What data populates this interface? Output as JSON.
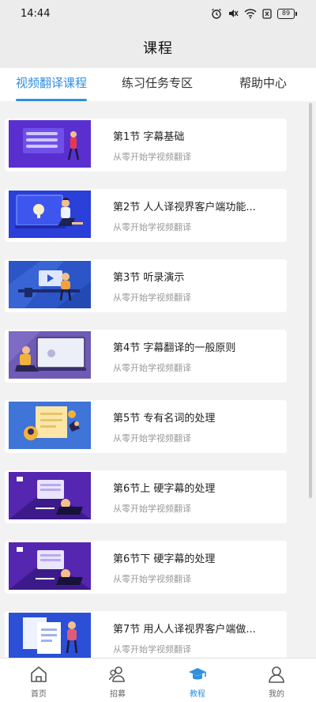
{
  "status_bar": {
    "time": "14:44",
    "battery": "89"
  },
  "header": {
    "title": "课程"
  },
  "tabs": [
    {
      "label": "视频翻译课程",
      "active": true
    },
    {
      "label": "练习任务专区",
      "active": false
    },
    {
      "label": "帮助中心",
      "active": false
    }
  ],
  "courses": [
    {
      "title": "第1节 字幕基础",
      "subtitle": "从零开始学视频翻译",
      "thumb_icon": "subtitle-basics-illustration"
    },
    {
      "title": "第2节 人人译视界客户端功能...",
      "subtitle": "从零开始学视频翻译",
      "thumb_icon": "client-features-illustration"
    },
    {
      "title": "第3节 听录演示",
      "subtitle": "从零开始学视频翻译",
      "thumb_icon": "transcription-demo-illustration"
    },
    {
      "title": "第4节 字幕翻译的一般原则",
      "subtitle": "从零开始学视频翻译",
      "thumb_icon": "translation-principles-illustration"
    },
    {
      "title": "第5节 专有名词的处理",
      "subtitle": "从零开始学视频翻译",
      "thumb_icon": "proper-nouns-illustration"
    },
    {
      "title": "第6节上 硬字幕的处理",
      "subtitle": "从零开始学视频翻译",
      "thumb_icon": "hard-subtitles-illustration"
    },
    {
      "title": "第6节下 硬字幕的处理",
      "subtitle": "从零开始学视频翻译",
      "thumb_icon": "hard-subtitles-illustration"
    },
    {
      "title": "第7节 用人人译视界客户端做...",
      "subtitle": "从零开始学视频翻译",
      "thumb_icon": "client-workflow-illustration"
    }
  ],
  "bottom_nav": [
    {
      "label": "首页",
      "icon": "home-icon",
      "active": false
    },
    {
      "label": "招募",
      "icon": "recruit-icon",
      "active": false
    },
    {
      "label": "教程",
      "icon": "graduation-cap-icon",
      "active": true
    },
    {
      "label": "我的",
      "icon": "profile-icon",
      "active": false
    }
  ],
  "colors": {
    "accent": "#2f8fe3",
    "page_bg": "#f2f2f2",
    "header_bg": "#ececec",
    "thumb_blue": "#2b4fd6",
    "thumb_purple": "#5b2bb8"
  }
}
